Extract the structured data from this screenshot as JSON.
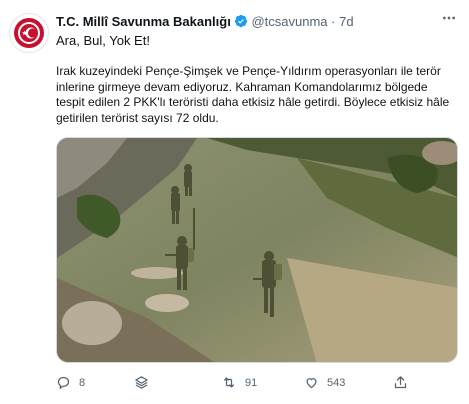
{
  "author": {
    "name": "T.C. Millî Savunma Bakanlığı",
    "handle": "@tcsavunma",
    "separator": "·",
    "time": "7d",
    "verified_icon": "verified-badge-icon",
    "avatar_icon": "ministry-emblem-icon"
  },
  "tweet": {
    "lead": "Ara, Bul, Yok Et!",
    "text": "Irak kuzeyindeki Pençe-Şimşek ve Pençe-Yıldırım operasyonları ile terör inlerine girmeye devam ediyoruz. Kahraman Komandolarımız bölgede tespit edilen 2 PKK'lı teröristi daha etkisiz hâle getirdi. Böylece etkisiz hâle getirilen terörist sayısı 72 oldu."
  },
  "actions": {
    "reply_count": "8",
    "retweet_count": "91",
    "like_count": "543",
    "icons": [
      "reply-icon",
      "stack-icon",
      "retweet-icon",
      "like-icon",
      "share-icon"
    ]
  },
  "colors": {
    "accent": "#1d9bf0",
    "secondary_text": "#536471",
    "emblem_red": "#c8102e"
  }
}
